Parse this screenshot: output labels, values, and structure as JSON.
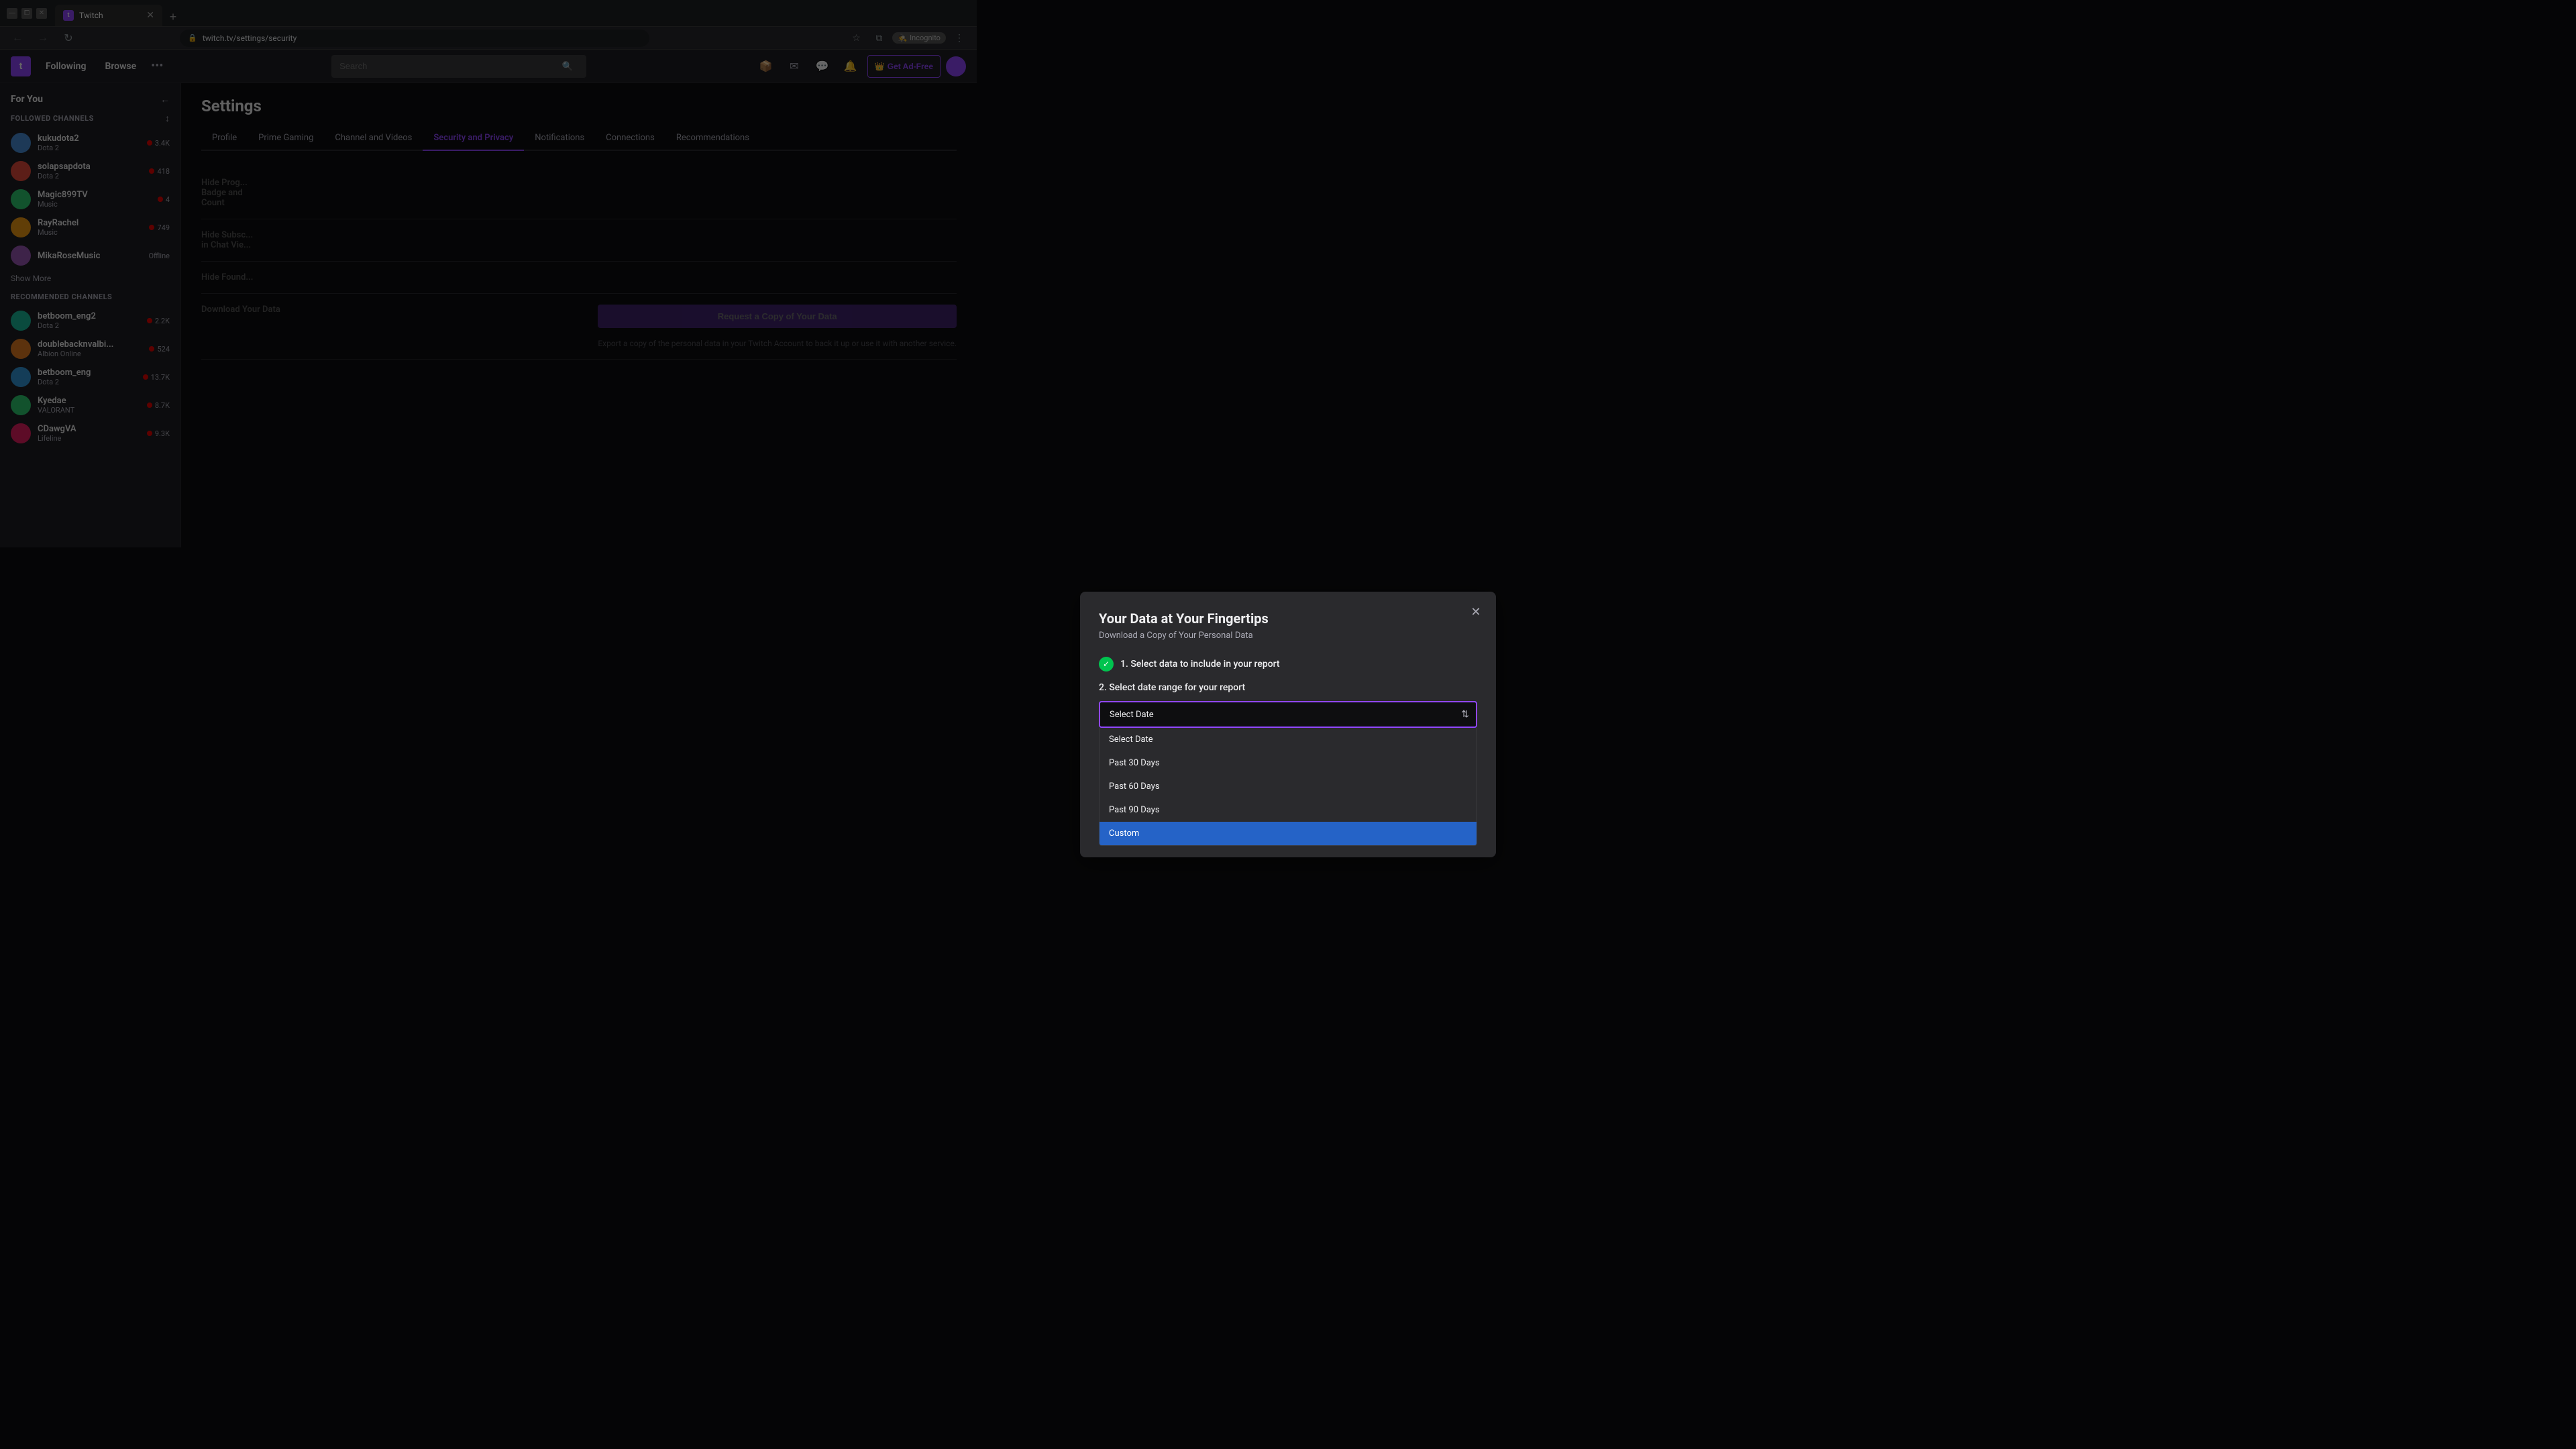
{
  "browser": {
    "tab_title": "Twitch",
    "tab_favicon": "t",
    "url": "twitch.tv/settings/security",
    "new_tab_label": "+",
    "incognito_label": "Incognito",
    "back_btn": "←",
    "forward_btn": "→",
    "refresh_btn": "↻",
    "star_icon": "☆",
    "window_split_icon": "⧉",
    "more_icon": "⋮",
    "minimize": "—",
    "maximize": "⧠",
    "close": "✕"
  },
  "twitch_nav": {
    "logo": "t",
    "following": "Following",
    "browse": "Browse",
    "more_icon": "•••",
    "search_placeholder": "Search",
    "get_ad_free": "Get Ad-Free",
    "prime_icon": "👑"
  },
  "sidebar": {
    "for_you_title": "For You",
    "followed_channels_label": "FOLLOWED CHANNELS",
    "recommended_label": "RECOMMENDED CHANNELS",
    "show_more": "Show More",
    "channels": [
      {
        "name": "kukudota2",
        "game": "Dota 2",
        "viewers": "3.4K",
        "live": true,
        "color": "avatar-1"
      },
      {
        "name": "solapsapdota",
        "game": "Dota 2",
        "viewers": "418",
        "live": true,
        "color": "avatar-2"
      },
      {
        "name": "Magic899TV",
        "game": "Music",
        "viewers": "4",
        "live": true,
        "color": "avatar-3"
      },
      {
        "name": "RayRachel",
        "game": "Music",
        "viewers": "749",
        "live": true,
        "color": "avatar-4"
      },
      {
        "name": "MikaRoseMusic",
        "game": "",
        "viewers": "Offline",
        "live": false,
        "color": "avatar-5"
      }
    ],
    "recommended_channels": [
      {
        "name": "betboom_eng2",
        "game": "Dota 2",
        "viewers": "2.2K",
        "live": true,
        "color": "avatar-6"
      },
      {
        "name": "doublebacknvalbi...",
        "game": "Albion Online",
        "viewers": "524",
        "live": true,
        "color": "avatar-7"
      },
      {
        "name": "betboom_eng",
        "game": "Dota 2",
        "viewers": "13.7K",
        "live": true,
        "color": "avatar-8"
      },
      {
        "name": "Kyedae",
        "game": "VALORANT",
        "viewers": "8.7K",
        "live": true,
        "color": "avatar-3"
      },
      {
        "name": "CDawgVA",
        "game": "Lifeline",
        "viewers": "9.3K",
        "live": true,
        "color": "avatar-9"
      }
    ]
  },
  "settings": {
    "page_title": "Settings",
    "tabs": [
      {
        "label": "Profile",
        "active": false
      },
      {
        "label": "Prime Gaming",
        "active": false
      },
      {
        "label": "Channel and Videos",
        "active": false
      },
      {
        "label": "Security and Privacy",
        "active": true
      },
      {
        "label": "Notifications",
        "active": false
      },
      {
        "label": "Connections",
        "active": false
      },
      {
        "label": "Recommendations",
        "active": false
      }
    ],
    "rows": [
      {
        "label": "Hide Prog..."
      },
      {
        "label": "Badge and"
      },
      {
        "label": "Count"
      },
      {
        "label": "Hide Subsc..."
      },
      {
        "label": "in Chat Vie..."
      },
      {
        "label": "Hide Found..."
      },
      {
        "label": "Download Your Data"
      }
    ]
  },
  "modal": {
    "title": "Your Data at Your Fingertips",
    "subtitle": "Download a Copy of Your Personal Data",
    "close_icon": "✕",
    "step1_label": "1. Select data to include in your report",
    "step2_label": "2. Select date range for your report",
    "select_placeholder": "Select Date",
    "select_options": [
      {
        "label": "Select Date",
        "value": "select_date"
      },
      {
        "label": "Past 30 Days",
        "value": "past_30"
      },
      {
        "label": "Past 60 Days",
        "value": "past_60"
      },
      {
        "label": "Past 90 Days",
        "value": "past_90"
      },
      {
        "label": "Custom",
        "value": "custom"
      }
    ],
    "download_label": "Download Your Data",
    "request_btn": "Request a Copy of Your Data",
    "export_note": "Export a copy of the personal data in your Twitch Account to back it up or use it with another service.",
    "check_icon": "✓"
  }
}
